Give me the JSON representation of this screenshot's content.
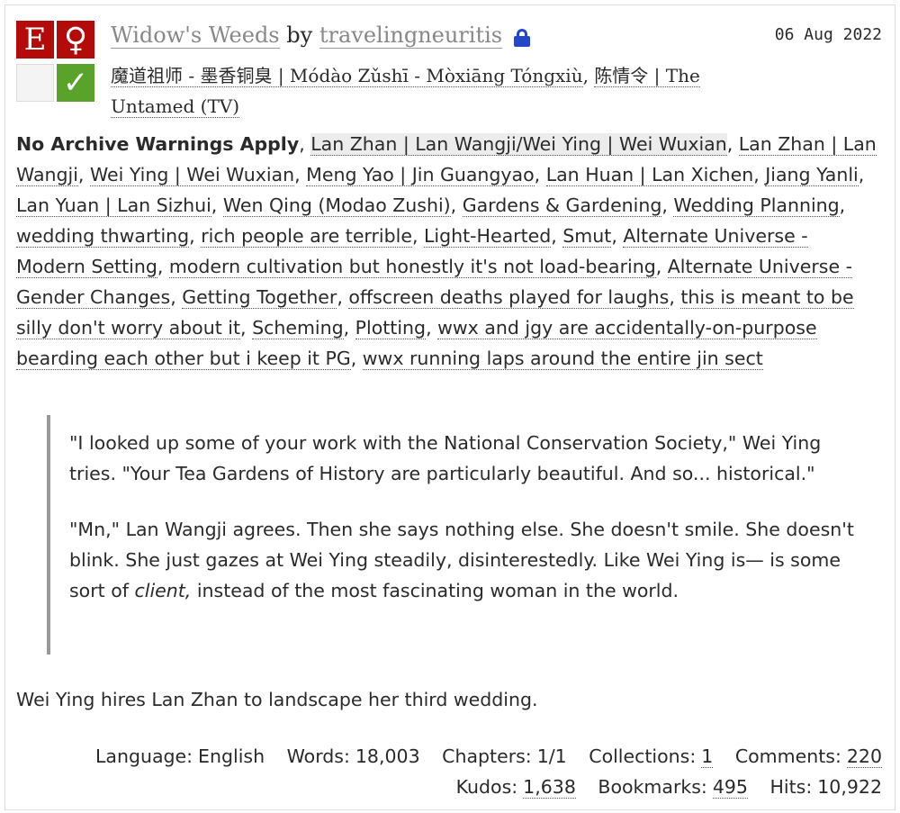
{
  "work": {
    "title": "Widow's Weeds",
    "by": "by",
    "author": "travelingneuritis",
    "date": "06 Aug 2022",
    "fandoms": [
      "魔道祖师 - 墨香铜臭 | Mó​dào Zǔ​shī - Mòxiāng Tóngxiù",
      "陈情令 | The Untamed (TV)"
    ],
    "icons": {
      "rating": "E",
      "category": "♀",
      "complete": "✓",
      "rating_color": "#b30a0a",
      "complete_color": "#59a32a",
      "lock_color": "#2347c8"
    }
  },
  "tags": {
    "warning": "No Archive Warnings Apply",
    "relationship": "Lan Zhan | Lan Wangji/Wei Ying | Wei Wuxian",
    "items": [
      "Lan Zhan | Lan Wangji",
      "Wei Ying | Wei Wuxian",
      "Meng Yao | Jin Guangyao",
      "Lan Huan | Lan Xichen",
      "Jiang Yanli",
      "Lan Yuan | Lan Sizhui",
      "Wen Qing (Modao Zushi)",
      "Gardens & Gardening",
      "Wedding Planning",
      "wedding thwarting",
      "rich people are terrible",
      "Light-Hearted",
      "Smut",
      "Alternate Universe - Modern Setting",
      "modern cultivation but honestly it's not load-bearing",
      "Alternate Universe - Gender Changes",
      "Getting Together",
      "offscreen deaths played for laughs",
      "this is meant to be silly don't worry about it",
      "Scheming",
      "Plotting",
      "wwx and jgy are accidentally-on-purpose bearding each other but i keep it PG",
      "wwx running laps around the entire jin sect"
    ]
  },
  "summary": {
    "p1": "\"I looked up some of your work with the National Conservation Society,\" Wei Ying tries. \"Your Tea Gardens of History are particularly beautiful. And so... historical.\"",
    "p2_before": "\"Mn,\" Lan Wangji agrees. Then she says nothing else. She doesn't smile. She doesn't blink. She just gazes at Wei Ying steadily, disinterestedly. Like Wei Ying is— is some sort of ",
    "p2_em": "client,",
    "p2_after": " instead of the most fascinating woman in the world.",
    "excerpt": "Wei Ying hires Lan Zhan to landscape her third wedding."
  },
  "stats": {
    "language_label": "Language:",
    "language": "English",
    "words_label": "Words:",
    "words": "18,003",
    "chapters_label": "Chapters:",
    "chapters": "1/1",
    "collections_label": "Collections:",
    "collections": "1",
    "comments_label": "Comments:",
    "comments": "220",
    "kudos_label": "Kudos:",
    "kudos": "1,638",
    "bookmarks_label": "Bookmarks:",
    "bookmarks": "495",
    "hits_label": "Hits:",
    "hits": "10,922"
  }
}
